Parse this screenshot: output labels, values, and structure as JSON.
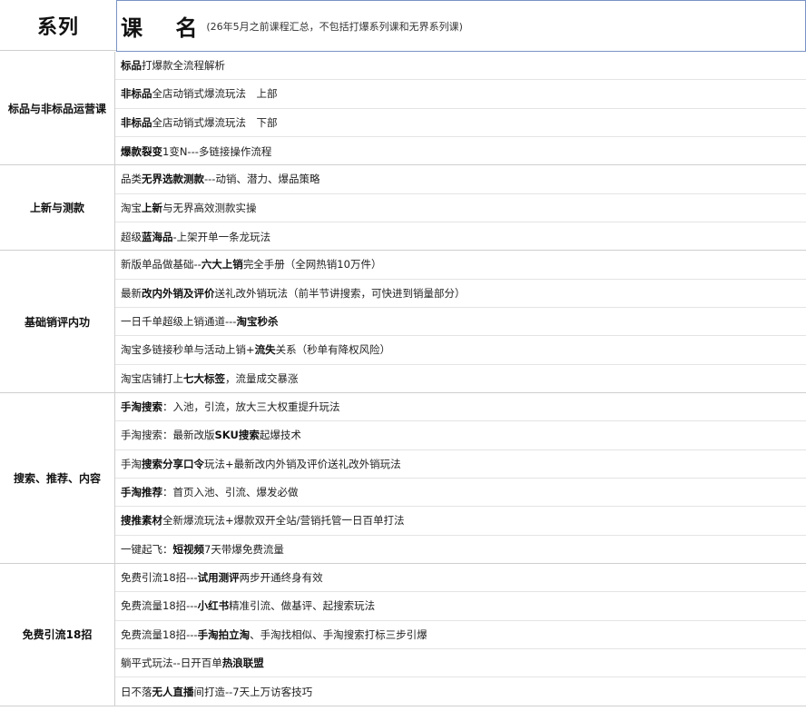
{
  "header": {
    "series_label": "系列",
    "course_label": "课 名",
    "course_note": "(26年5月之前课程汇总，不包括打爆系列课和无界系列课)"
  },
  "groups": [
    {
      "label": "标品与非标品运营课",
      "rows": [
        [
          {
            "t": "标品",
            "b": true
          },
          {
            "t": "打爆款全流程解析",
            "b": false
          }
        ],
        [
          {
            "t": "非标品",
            "b": true
          },
          {
            "t": "全店动销式爆流玩法　上部",
            "b": false
          }
        ],
        [
          {
            "t": "非标品",
            "b": true
          },
          {
            "t": "全店动销式爆流玩法　下部",
            "b": false
          }
        ],
        [
          {
            "t": "爆款裂变",
            "b": true
          },
          {
            "t": "1变N---多链接操作流程",
            "b": false
          }
        ]
      ]
    },
    {
      "label": "上新与测款",
      "rows": [
        [
          {
            "t": "品类",
            "b": false
          },
          {
            "t": "无界选款测款",
            "b": true
          },
          {
            "t": "---动销、潜力、爆品策略",
            "b": false
          }
        ],
        [
          {
            "t": "淘宝",
            "b": false
          },
          {
            "t": "上新",
            "b": true
          },
          {
            "t": "与无界高效测款实操",
            "b": false
          }
        ],
        [
          {
            "t": "超级",
            "b": false
          },
          {
            "t": "蓝海品",
            "b": true
          },
          {
            "t": "-上架开单一条龙玩法",
            "b": false
          }
        ]
      ]
    },
    {
      "label": "基础销评内功",
      "rows": [
        [
          {
            "t": "新版单品做基础--",
            "b": false
          },
          {
            "t": "六大上销",
            "b": true
          },
          {
            "t": "完全手册（全网热销10万件）",
            "b": false
          }
        ],
        [
          {
            "t": "最新",
            "b": false
          },
          {
            "t": "改内外销及评价",
            "b": true
          },
          {
            "t": "送礼改外销玩法（前半节讲搜索，可快进到销量部分）",
            "b": false
          }
        ],
        [
          {
            "t": "一日千单超级上销通道---",
            "b": false
          },
          {
            "t": "淘宝秒杀",
            "b": true
          }
        ],
        [
          {
            "t": "淘宝多链接秒单与活动上销+",
            "b": false
          },
          {
            "t": "流失",
            "b": true
          },
          {
            "t": "关系（秒单有降权风险）",
            "b": false
          }
        ],
        [
          {
            "t": "淘宝店铺打上",
            "b": false
          },
          {
            "t": "七大标签",
            "b": true
          },
          {
            "t": "，流量成交暴涨",
            "b": false
          }
        ]
      ]
    },
    {
      "label": "搜索、推荐、内容",
      "rows": [
        [
          {
            "t": "手淘搜索",
            "b": true
          },
          {
            "t": "：入池，引流，放大三大权重提升玩法",
            "b": false
          }
        ],
        [
          {
            "t": "手淘搜索：最新改版",
            "b": false
          },
          {
            "t": "SKU搜索",
            "b": true
          },
          {
            "t": "起爆技术",
            "b": false
          }
        ],
        [
          {
            "t": "手淘",
            "b": false
          },
          {
            "t": "搜索分享口令",
            "b": true
          },
          {
            "t": "玩法+最新改内外销及评价送礼改外销玩法",
            "b": false
          }
        ],
        [
          {
            "t": "手淘推荐",
            "b": true
          },
          {
            "t": "：首页入池、引流、爆发必做",
            "b": false
          }
        ],
        [
          {
            "t": "搜推素材",
            "b": true
          },
          {
            "t": "全新爆流玩法+爆款双开全站/营销托管一日百单打法",
            "b": false
          }
        ],
        [
          {
            "t": "一键起飞：",
            "b": false
          },
          {
            "t": "短视频",
            "b": true
          },
          {
            "t": "7天带爆免费流量",
            "b": false
          }
        ]
      ]
    },
    {
      "label": "免费引流18招",
      "rows": [
        [
          {
            "t": "免费引流18招---",
            "b": false
          },
          {
            "t": "试用测评",
            "b": true
          },
          {
            "t": "两步开通终身有效",
            "b": false
          }
        ],
        [
          {
            "t": "免费流量18招---",
            "b": false
          },
          {
            "t": "小红书",
            "b": true
          },
          {
            "t": "精准引流、做基评、起搜索玩法",
            "b": false
          }
        ],
        [
          {
            "t": "免费流量18招---",
            "b": false
          },
          {
            "t": "手淘拍立淘",
            "b": true
          },
          {
            "t": "、手淘找相似、手淘搜索打标三步引爆",
            "b": false
          }
        ],
        [
          {
            "t": "躺平式玩法--日开百单",
            "b": false
          },
          {
            "t": "热浪联盟",
            "b": true
          }
        ],
        [
          {
            "t": "日不落",
            "b": false
          },
          {
            "t": "无人直播",
            "b": true
          },
          {
            "t": "间打造--7天上万访客技巧",
            "b": false
          }
        ]
      ]
    }
  ]
}
